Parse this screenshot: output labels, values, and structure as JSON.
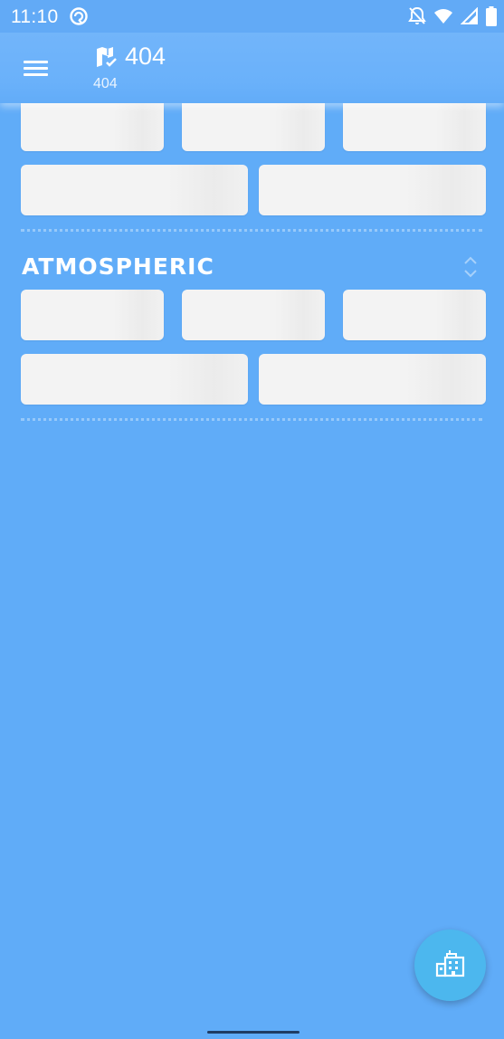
{
  "status_bar": {
    "time": "11:10",
    "left_icon": "sync-badge-icon",
    "right_icons": [
      "notifications-off-icon",
      "wifi-icon",
      "cellular-signal-icon",
      "battery-icon"
    ]
  },
  "app_bar": {
    "title": "404",
    "subtitle": "404",
    "title_icon": "map-check-icon",
    "menu_icon": "hamburger-menu-icon"
  },
  "sections": [
    {
      "title": "",
      "row1_tiles": 3,
      "row2_tiles": 2
    },
    {
      "title": "ATMOSPHERIC",
      "row1_tiles": 3,
      "row2_tiles": 2
    }
  ],
  "fab": {
    "icon": "city-buildings-icon"
  },
  "colors": {
    "background": "#60acf8",
    "tile": "#f3f3f3",
    "fab": "#4cb7ee",
    "text": "#ffffff"
  }
}
